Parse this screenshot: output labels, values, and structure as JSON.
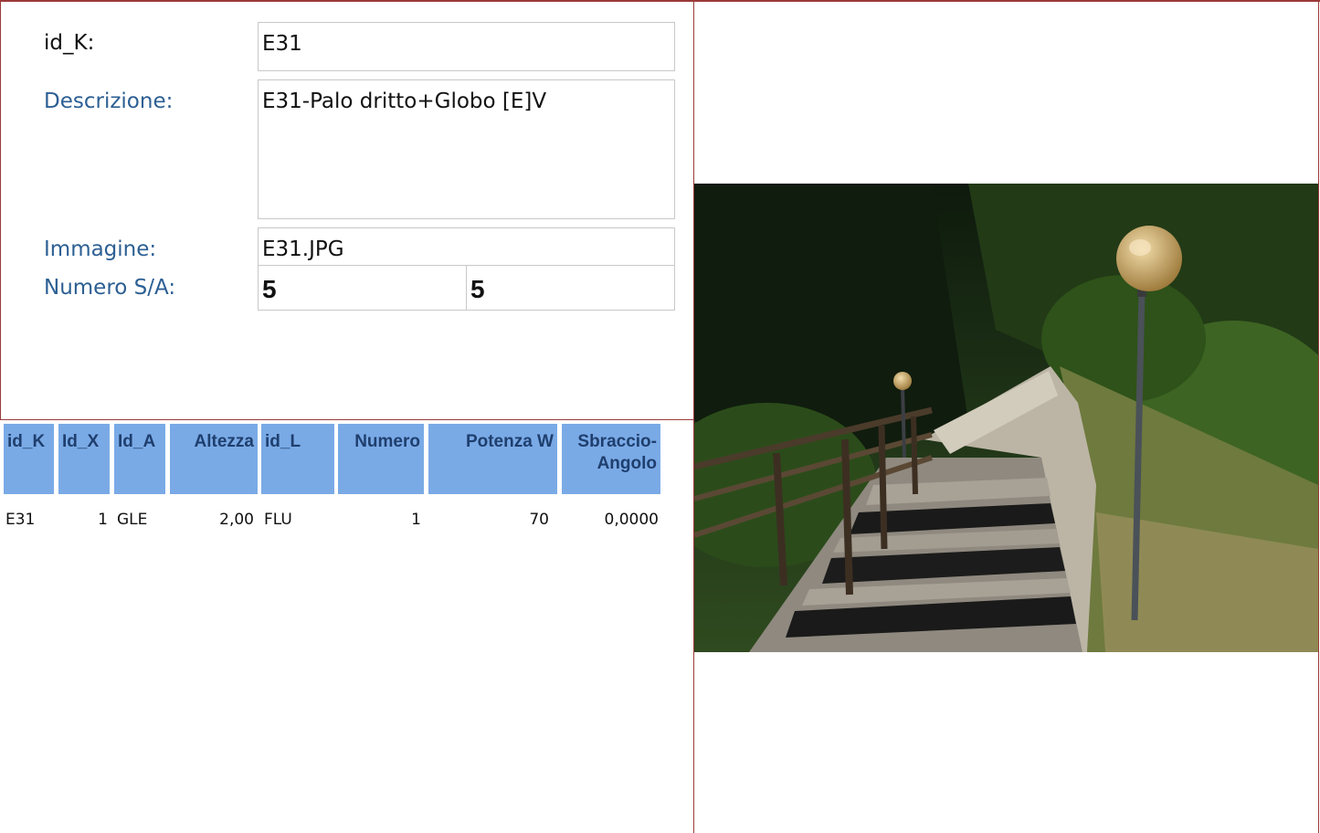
{
  "form": {
    "id_k_label": "id_K:",
    "id_k_value": "E31",
    "descrizione_label": "Descrizione:",
    "descrizione_value": "E31-Palo dritto+Globo [E]V",
    "immagine_label": "Immagine:",
    "immagine_value": "E31.JPG",
    "numero_sa_label": "Numero S/A:",
    "numero_s_value": "5",
    "numero_a_value": "5"
  },
  "table": {
    "headers": [
      "id_K",
      "Id_X",
      "Id_A",
      "Altezza",
      "id_L",
      "Numero",
      "Potenza W",
      "Sbraccio-Angolo"
    ],
    "header_sbraccio_line1": "Sbraccio-",
    "header_sbraccio_line2": "Angolo",
    "rows": [
      [
        "E31",
        "1",
        "GLE",
        "2,00",
        "FLU",
        "1",
        "70",
        "0,0000"
      ]
    ]
  },
  "photo": {
    "icon": "streetlamp-photo",
    "colors": {
      "sky_dark": "#0d1a0f",
      "foliage": "#3a5a1e",
      "wall": "#b8b2a4",
      "steps": "#9b948a",
      "globe": "#c9a35a"
    }
  }
}
